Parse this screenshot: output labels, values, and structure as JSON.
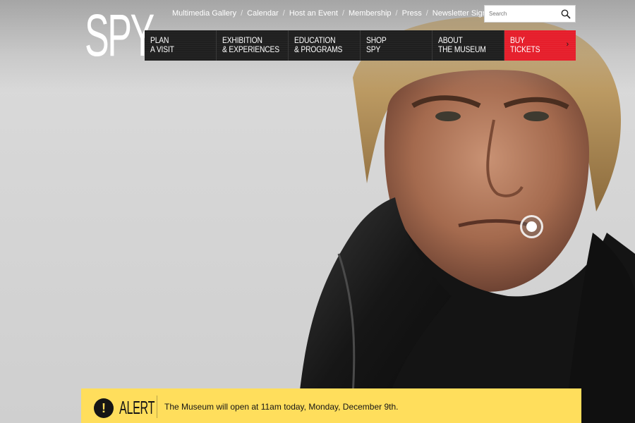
{
  "brand": {
    "logo_text": "SPY"
  },
  "utility_nav": [
    {
      "label": "Multimedia Gallery"
    },
    {
      "label": "Calendar"
    },
    {
      "label": "Host an Event"
    },
    {
      "label": "Membership"
    },
    {
      "label": "Press"
    },
    {
      "label": "Newsletter Sign Up"
    }
  ],
  "search": {
    "placeholder": "Search",
    "icon": "search-icon"
  },
  "main_nav": [
    {
      "line1": "PLAN",
      "line2": "A VISIT"
    },
    {
      "line1": "EXHIBITION",
      "line2": "& EXPERIENCES"
    },
    {
      "line1": "EDUCATION",
      "line2": "& PROGRAMS"
    },
    {
      "line1": "SHOP",
      "line2": "SPY"
    },
    {
      "line1": "ABOUT",
      "line2": "THE MUSEUM"
    },
    {
      "line1": "BUY",
      "line2": "TICKETS",
      "arrow": "›"
    }
  ],
  "alert": {
    "icon_glyph": "!",
    "label": "ALERT",
    "message": "The Museum will open at 11am today, Monday, December 9th."
  },
  "colors": {
    "nav_bg": "#1f1f1f",
    "buy_bg": "#e61e2b",
    "alert_bg": "#ffde5c"
  }
}
